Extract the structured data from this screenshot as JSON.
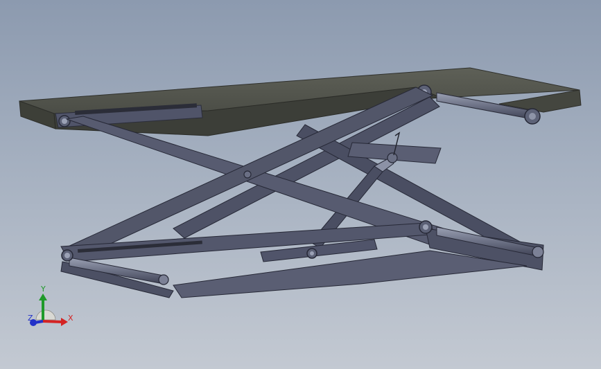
{
  "viewport": {
    "background_top": "#8c9aaf",
    "background_bottom": "#c3c9d2",
    "model_color": "#565a6e",
    "platform_color": "#4d4f48"
  },
  "triad": {
    "x_label": "X",
    "y_label": "Y",
    "z_label": "Z",
    "x_color": "#d42323",
    "y_color": "#1f9a2a",
    "z_color": "#2231c8"
  }
}
